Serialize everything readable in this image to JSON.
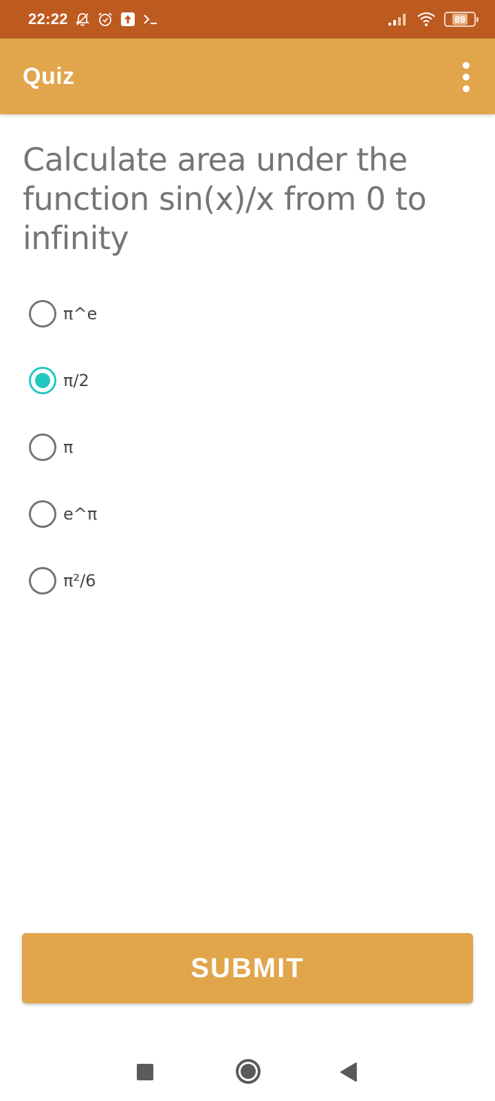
{
  "status_bar": {
    "time": "22:22",
    "icons": [
      "notifications-off-icon",
      "alarm-icon",
      "upload-icon",
      "terminal-icon",
      "signal-icon",
      "wifi-icon",
      "battery-icon"
    ],
    "battery_level": "89"
  },
  "app_bar": {
    "title": "Quiz",
    "menu_icon": "more-vert-icon"
  },
  "quiz": {
    "question": "Calculate area under the function sin(x)/x from 0 to infinity",
    "options": [
      {
        "label": "π^e",
        "selected": false
      },
      {
        "label": "π/2",
        "selected": true
      },
      {
        "label": "π",
        "selected": false
      },
      {
        "label": "e^π",
        "selected": false
      },
      {
        "label": "π²/6",
        "selected": false
      }
    ],
    "submit_label": "SUBMIT"
  },
  "nav_bar": {
    "icons": [
      "recents-icon",
      "home-icon",
      "back-icon"
    ]
  },
  "colors": {
    "status_bar": "#bd5a1f",
    "app_bar": "#e1a54b",
    "accent": "#22c7c2",
    "question_text": "#757575"
  }
}
